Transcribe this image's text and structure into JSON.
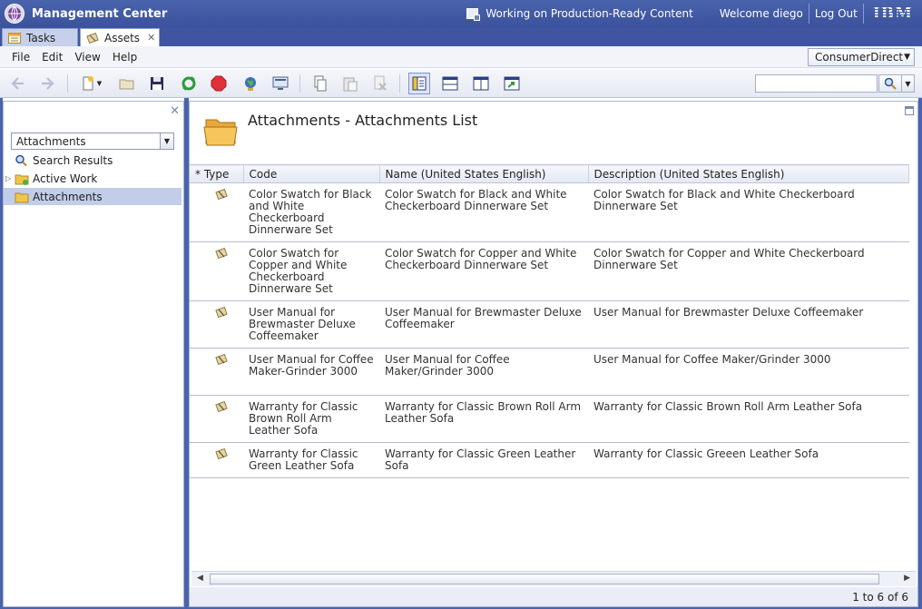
{
  "window": {
    "title": "Management Center",
    "status_text": "Working on Production-Ready Content",
    "welcome_text": "Welcome diego",
    "logout_label": "Log Out",
    "brand": "IBM"
  },
  "tabs": [
    {
      "label": "Tasks",
      "icon": "tasks-icon",
      "active": false
    },
    {
      "label": "Assets",
      "icon": "assets-icon",
      "active": true
    }
  ],
  "menu": {
    "items": [
      "File",
      "Edit",
      "View",
      "Help"
    ],
    "store_selected": "ConsumerDirect"
  },
  "toolbar": {
    "buttons": [
      "back-icon",
      "forward-icon",
      "new-icon",
      "open-icon",
      "save-icon",
      "refresh-icon",
      "stop-icon",
      "globe-icon",
      "preview-icon",
      "copy-icon",
      "paste-icon",
      "delete-icon",
      "list-view-icon",
      "horizontal-split-icon",
      "vertical-split-icon",
      "export-icon"
    ],
    "search_placeholder": ""
  },
  "explorer": {
    "filter_selected": "Attachments",
    "items": [
      {
        "label": "Search Results",
        "icon": "search-icon"
      },
      {
        "label": "Active Work",
        "icon": "folder-icon"
      },
      {
        "label": "Attachments",
        "icon": "folder-icon",
        "selected": true
      }
    ]
  },
  "main": {
    "title": "Attachments - Attachments List",
    "columns": [
      "* Type",
      "Code",
      "Name (United States English)",
      "Description (United States English)"
    ],
    "rows": [
      {
        "code": "Color Swatch for Black and White Checkerboard Dinnerware Set",
        "name": "Color Swatch for Black and White Checkerboard Dinnerware Set",
        "description": "Color Swatch for Black and White Checkerboard Dinnerware Set"
      },
      {
        "code": "Color Swatch for Copper and White Checkerboard Dinnerware Set",
        "name": "Color Swatch for Copper and White Checkerboard Dinnerware Set",
        "description": "Color Swatch for Copper and White Checkerboard Dinnerware Set"
      },
      {
        "code": "User Manual for Brewmaster Deluxe Coffeemaker",
        "name": "User Manual for Brewmaster Deluxe Coffeemaker",
        "description": "User Manual for Brewmaster Deluxe Coffeemaker"
      },
      {
        "code": "User Manual for Coffee Maker-Grinder 3000",
        "name": "User Manual for Coffee Maker/Grinder 3000",
        "description": "User Manual for Coffee Maker/Grinder 3000"
      },
      {
        "code": "Warranty for Classic Brown Roll Arm Leather Sofa",
        "name": "Warranty for Classic Brown Roll Arm Leather Sofa",
        "description": "Warranty for Classic Brown Roll Arm Leather Sofa"
      },
      {
        "code": "Warranty for Classic Green Leather Sofa",
        "name": "Warranty for Classic Green Leather Sofa",
        "description": "Warranty for Classic Greeen Leather Sofa"
      }
    ],
    "pagination": "1 to 6 of 6"
  },
  "colors": {
    "title_bar": "#3f55a1",
    "selected_row": "#c1cde9"
  }
}
